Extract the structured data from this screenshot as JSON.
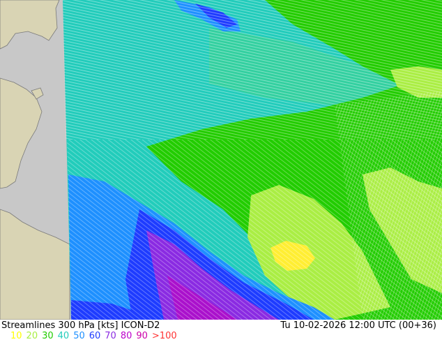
{
  "title": "Streamlines 300 hPa [kts] ICON-D2",
  "valid_time": "Tu 10-02-2026 12:00 UTC (00+36)",
  "legend": [
    {
      "label": "10",
      "color": "#ffff00"
    },
    {
      "label": "20",
      "color": "#aaee44"
    },
    {
      "label": "30",
      "color": "#22cc00"
    },
    {
      "label": "40",
      "color": "#22ccbb"
    },
    {
      "label": "50",
      "color": "#1e90ff"
    },
    {
      "label": "60",
      "color": "#1e3cff"
    },
    {
      "label": "70",
      "color": "#8a2be2"
    },
    {
      "label": "80",
      "color": "#bb00cc"
    },
    {
      "label": "90",
      "color": "#cc00aa"
    },
    {
      "label": ">100",
      "color": "#ff3333"
    }
  ],
  "colors": {
    "land": "#d9d4b4",
    "sea": "#c8c8c8",
    "coast": "#7a7a7a"
  }
}
